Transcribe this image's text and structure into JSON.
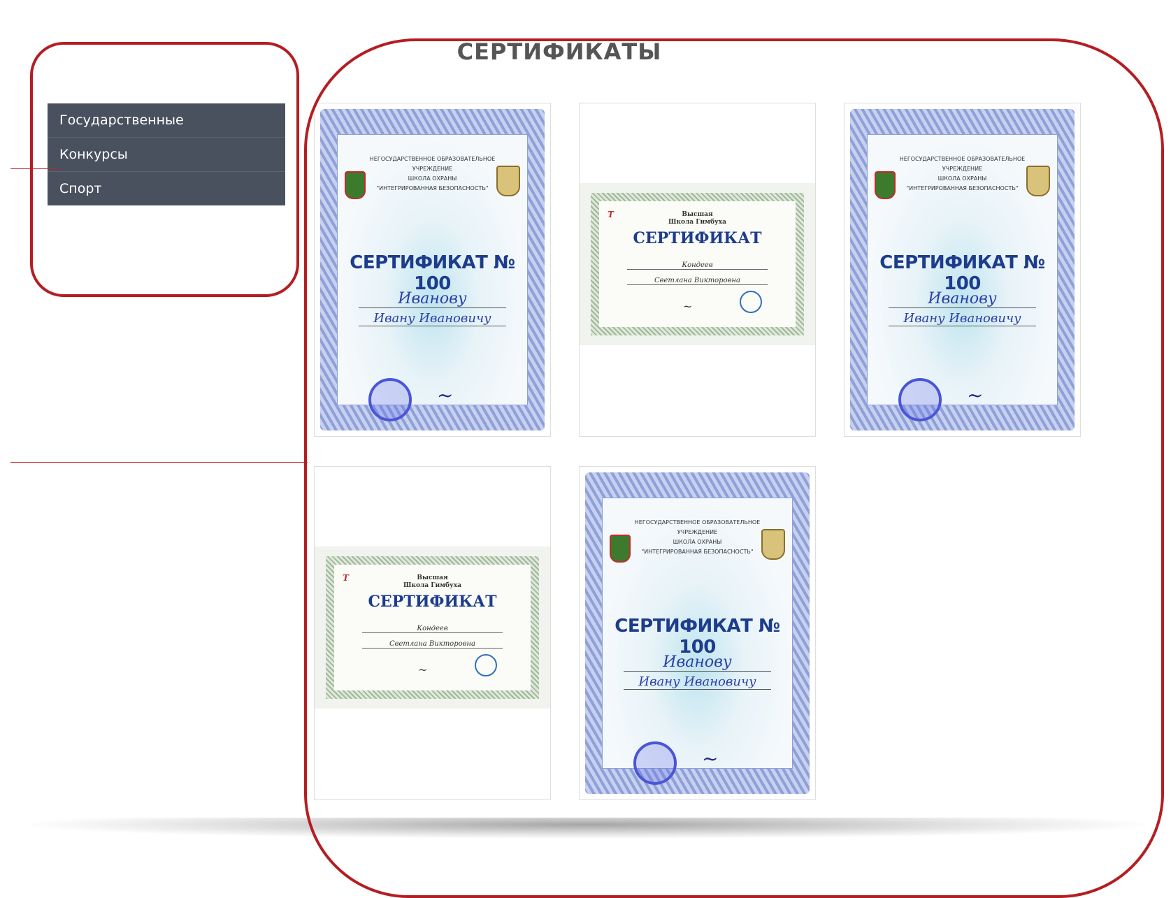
{
  "page": {
    "title": "СЕРТИФИКАТЫ"
  },
  "sidebar": {
    "items": [
      {
        "label": "Государственные"
      },
      {
        "label": "Конкурсы"
      },
      {
        "label": "Спорт"
      }
    ]
  },
  "certificates": [
    {
      "type": "blue",
      "org": "НЕГОСУДАРСТВЕННОЕ ОБРАЗОВАТЕЛЬНОЕ УЧРЕЖДЕНИЕ\nШКОЛА ОХРАНЫ\n\"ИНТЕГРИРОВАННАЯ БЕЗОПАСНОСТЬ\"",
      "heading": "СЕРТИФИКАТ №",
      "number": "100",
      "surname": "Иванову",
      "name": "Ивану   Ивановичу"
    },
    {
      "type": "green",
      "school": "Высшая\nШкола Гимбуха",
      "heading": "СЕРТИФИКАТ",
      "line1": "Кондеев",
      "line2": "Светлана Викторовна"
    },
    {
      "type": "blue",
      "org": "НЕГОСУДАРСТВЕННОЕ ОБРАЗОВАТЕЛЬНОЕ УЧРЕЖДЕНИЕ\nШКОЛА ОХРАНЫ\n\"ИНТЕГРИРОВАННАЯ БЕЗОПАСНОСТЬ\"",
      "heading": "СЕРТИФИКАТ №",
      "number": "100",
      "surname": "Иванову",
      "name": "Ивану   Ивановичу"
    },
    {
      "type": "green",
      "school": "Высшая\nШкола Гимбуха",
      "heading": "СЕРТИФИКАТ",
      "line1": "Кондеев",
      "line2": "Светлана Викторовна"
    },
    {
      "type": "blue",
      "org": "НЕГОСУДАРСТВЕННОЕ ОБРАЗОВАТЕЛЬНОЕ УЧРЕЖДЕНИЕ\nШКОЛА ОХРАНЫ\n\"ИНТЕГРИРОВАННАЯ БЕЗОПАСНОСТЬ\"",
      "heading": "СЕРТИФИКАТ №",
      "number": "100",
      "surname": "Иванову",
      "name": "Ивану   Ивановичу"
    }
  ],
  "colors": {
    "sidebar_bg": "#4a515e",
    "annotation_red": "#b41e22",
    "cert_heading_blue": "#1d3c8c"
  }
}
